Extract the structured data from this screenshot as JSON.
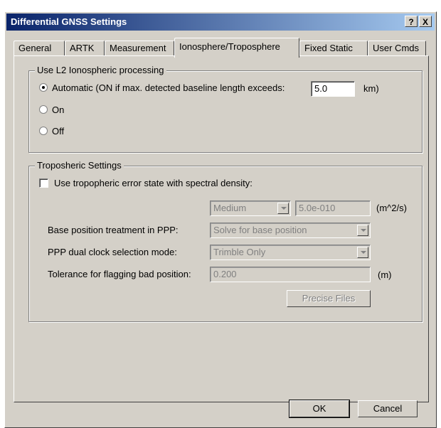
{
  "window": {
    "title": "Differential GNSS Settings",
    "help_label": "?",
    "close_label": "X"
  },
  "tabs": [
    {
      "label": "General"
    },
    {
      "label": "ARTK"
    },
    {
      "label": "Measurement"
    },
    {
      "label": "Ionosphere/Troposphere",
      "active": true
    },
    {
      "label": "Fixed Static"
    },
    {
      "label": "User Cmds"
    }
  ],
  "iono": {
    "legend": "Use L2 Ionospheric processing",
    "option_auto": "Automatic (ON if max. detected baseline length exceeds:",
    "baseline_value": "5.0",
    "unit": "km)",
    "option_on": "On",
    "option_off": "Off",
    "selected": "auto"
  },
  "tropo": {
    "legend": "Troposheric Settings",
    "use_state_label": "Use tropopheric error state with spectral density:",
    "use_state_checked": false,
    "density_level": "Medium",
    "density_value": "5.0e-010",
    "density_unit": "(m^2/s)",
    "base_label": "Base position treatment in PPP:",
    "base_value": "Solve for base position",
    "clock_label": "PPP dual clock selection mode:",
    "clock_value": "Trimble Only",
    "tolerance_label": "Tolerance for flagging bad position:",
    "tolerance_value": "0.200",
    "tolerance_unit": "(m)",
    "precise_files_label": "Precise Files"
  },
  "footer": {
    "ok_label": "OK",
    "cancel_label": "Cancel"
  }
}
